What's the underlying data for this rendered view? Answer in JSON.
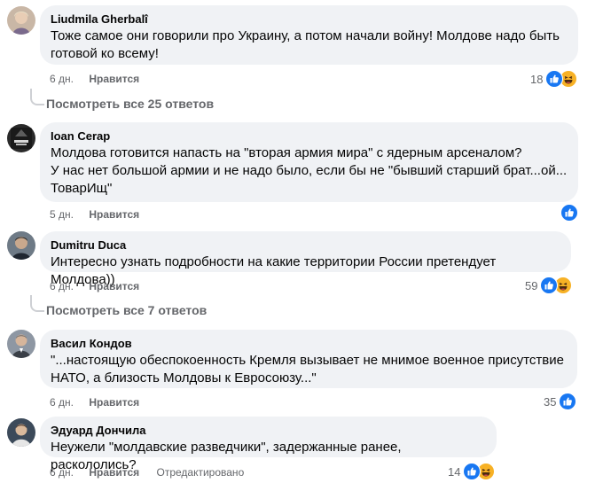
{
  "comments": [
    {
      "author": "Liudmila Gherbalî",
      "text_lines": [
        "Тоже самое они говорили про Украину, а потом начали войну! Молдове надо быть",
        "готовой ко всему!"
      ],
      "time": "6 дн.",
      "like_label": "Нравится",
      "reactions_count": "18",
      "reactions": [
        "like-icon",
        "haha-icon"
      ]
    },
    {
      "author": "Ioan Cerap",
      "text_lines": [
        "Молдова готовится напасть на \"вторая армия мира\" с ядерным арсеналом?",
        "У нас нет большой армии и не надо было, если бы не \"бывший старший брат...ой...",
        "ТоварИщ\""
      ],
      "time": "5 дн.",
      "like_label": "Нравится",
      "reactions_count": "",
      "reactions": [
        "like-icon"
      ]
    },
    {
      "author": "Dumitru Duca",
      "text_lines": [
        "Интересно узнать подробности на какие территории России претендует Молдова))"
      ],
      "time": "6 дн.",
      "like_label": "Нравится",
      "reactions_count": "59",
      "reactions": [
        "like-icon",
        "haha-icon"
      ]
    },
    {
      "author": "Васил Кондов",
      "text_lines": [
        "\"...настоящую обеспокоенность Кремля вызывает не мнимое военное присутствие",
        "НАТО, а близость Молдовы к Евросоюзу...\""
      ],
      "time": "6 дн.",
      "like_label": "Нравится",
      "reactions_count": "35",
      "reactions": [
        "like-icon"
      ]
    },
    {
      "author": "Эдуард Дончила",
      "text_lines": [
        "Неужели \"молдавские разведчики\", задержанные ранее, раскололись?"
      ],
      "time": "6 дн.",
      "like_label": "Нравится",
      "edited_label": "Отредактировано",
      "reactions_count": "14",
      "reactions": [
        "like-icon",
        "haha-icon"
      ]
    }
  ],
  "view_replies": [
    "Посмотреть все 25 ответов",
    "Посмотреть все 7 ответов"
  ],
  "colors": {
    "bubble": "#f0f2f5",
    "meta_text": "#65676b",
    "like_blue": "#1877f2",
    "haha_yellow": "#f7b125"
  }
}
